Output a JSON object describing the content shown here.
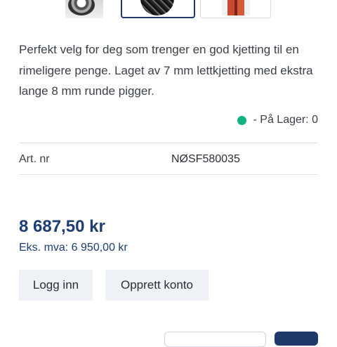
{
  "gallery": {
    "thumbnails": [
      "chain-image-1",
      "chain-image-2",
      "chain-image-3"
    ],
    "selected_index": 1
  },
  "product": {
    "description": "Perfekt velg for deg som trenger en god kjetting til en rimeligere penge. Laget av 7 mm lettkjetting med ekstra lange 8 mm runde pigger.",
    "stock_label": "- På Lager: 0",
    "stock_color": "#14b283",
    "art_nr_label": "Art. nr",
    "art_nr_value": "NØSF580035",
    "price": "8 687,50 kr",
    "price_ex_vat": "Eks. mva: 6 950,00 kr"
  },
  "actions": {
    "login": "Logg inn",
    "create_account": "Opprett konto"
  },
  "colors": {
    "brand": "#1d3d73",
    "button_bg": "#eef1f5"
  }
}
